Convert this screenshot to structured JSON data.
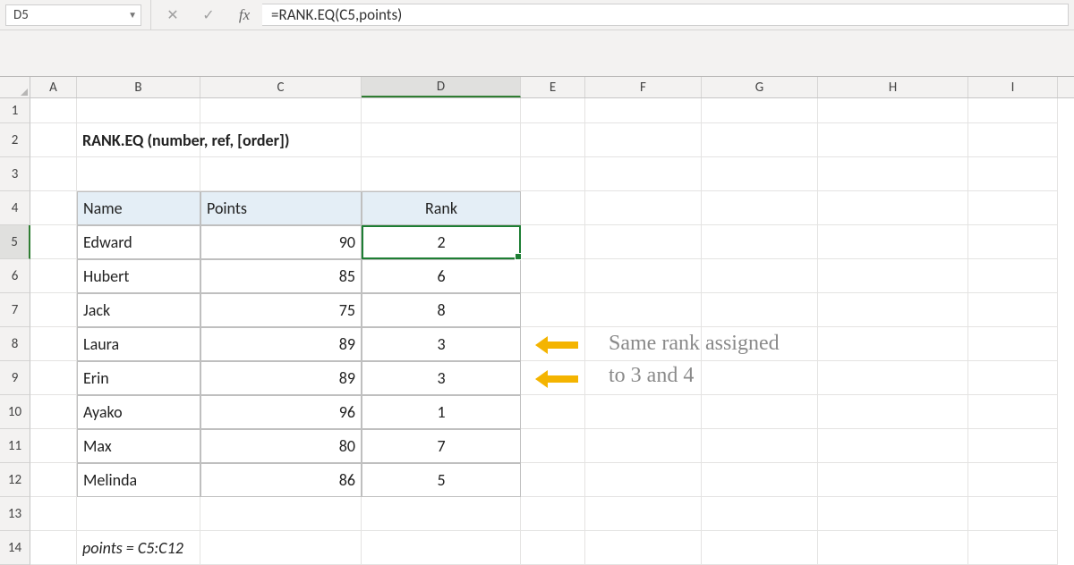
{
  "namebox": "D5",
  "formula": "=RANK.EQ(C5,points)",
  "fx_label": "fx",
  "columns": [
    "A",
    "B",
    "C",
    "D",
    "E",
    "F",
    "G",
    "H",
    "I"
  ],
  "active_col_index": 3,
  "row_numbers": [
    1,
    2,
    3,
    4,
    5,
    6,
    7,
    8,
    9,
    10,
    11,
    12,
    13,
    14
  ],
  "active_row": 5,
  "function_title": "RANK.EQ (number, ref, [order])",
  "table_headers": {
    "name": "Name",
    "points": "Points",
    "rank": "Rank"
  },
  "rows": [
    {
      "name": "Edward",
      "points": 90,
      "rank": 2
    },
    {
      "name": "Hubert",
      "points": 85,
      "rank": 6
    },
    {
      "name": "Jack",
      "points": 75,
      "rank": 8
    },
    {
      "name": "Laura",
      "points": 89,
      "rank": 3
    },
    {
      "name": "Erin",
      "points": 89,
      "rank": 3
    },
    {
      "name": "Ayako",
      "points": 96,
      "rank": 1
    },
    {
      "name": "Max",
      "points": 80,
      "rank": 7
    },
    {
      "name": "Melinda",
      "points": 86,
      "rank": 5
    }
  ],
  "named_range_note": "points = C5:C12",
  "annotation": {
    "line1": "Same rank assigned",
    "line2": "to 3 and 4"
  }
}
